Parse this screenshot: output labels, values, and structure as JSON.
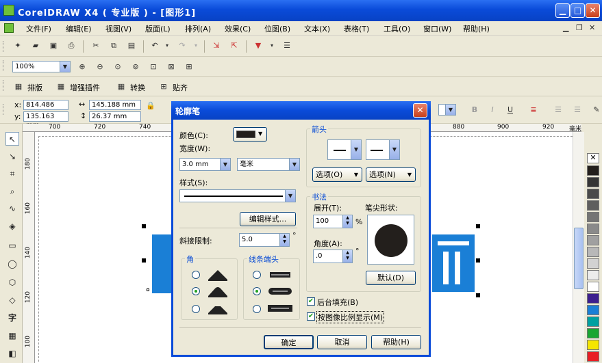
{
  "window": {
    "title": "CorelDRAW X4 ( 专业版 ) - [图形1]",
    "min_glyph": "▁",
    "max_glyph": "□",
    "close_glyph": "✕"
  },
  "menu": [
    "文件(F)",
    "编辑(E)",
    "视图(V)",
    "版面(L)",
    "排列(A)",
    "效果(C)",
    "位图(B)",
    "文本(X)",
    "表格(T)",
    "工具(O)",
    "窗口(W)",
    "帮助(H)"
  ],
  "zoom": {
    "value": "100%"
  },
  "plugins_toolbar": {
    "items": [
      "排版",
      "增强插件",
      "转换",
      "贴齐"
    ]
  },
  "props": {
    "x": "814.486 mm",
    "y": "135.163 mm",
    "w": "145.188 mm",
    "h": "26.37 mm"
  },
  "ruler_h": [
    "700",
    "720",
    "740",
    "880",
    "900",
    "920"
  ],
  "ruler_h_unit": "毫米",
  "ruler_v": [
    "180",
    "160",
    "140",
    "120",
    "100"
  ],
  "dialog": {
    "title": "轮廓笔",
    "color_label": "颜色(C):",
    "width_label": "宽度(W):",
    "width_value": "3.0 mm",
    "unit_value": "毫米",
    "style_label": "样式(S):",
    "edit_style_button": "编辑样式...",
    "miter_label": "斜接限制:",
    "miter_value": "5.0",
    "miter_unit": "°",
    "corners_group": "角",
    "linecaps_group": "线条端头",
    "arrows_group": "箭头",
    "arrow_options_left": "选项(O)",
    "arrow_options_right": "选项(N)",
    "calligraphy_group": "书法",
    "stretch_label": "展开(T):",
    "stretch_value": "100",
    "stretch_unit": "%",
    "nib_label": "笔尖形状:",
    "angle_label": "角度(A):",
    "angle_value": ".0",
    "angle_unit": "°",
    "default_button": "默认(D)",
    "behind_fill": "后台填充(B)",
    "scale_with_image": "按图像比例显示(M)",
    "ok": "确定",
    "cancel": "取消",
    "help": "帮助(H)"
  },
  "colors": {
    "accent": "#0a4bd9",
    "shape": "#1a7fd6",
    "swatch": "#231f1c"
  }
}
